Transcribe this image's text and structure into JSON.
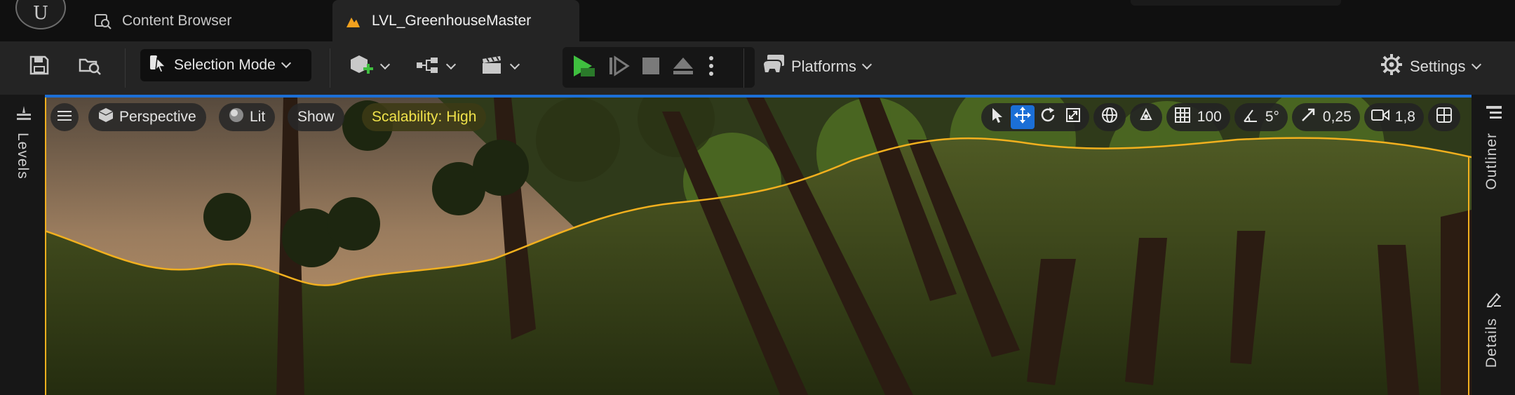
{
  "title_bar": {
    "tabs": [
      {
        "label": "Content Browser",
        "icon": "content-browser-icon"
      },
      {
        "label": "LVL_GreenhouseMaster",
        "icon": "level-icon"
      }
    ]
  },
  "toolbar": {
    "selection_mode": "Selection Mode",
    "platforms": "Platforms",
    "settings": "Settings"
  },
  "left_panel": {
    "levels_label": "Levels"
  },
  "right_panel": {
    "outliner_label": "Outliner",
    "details_label": "Details"
  },
  "viewport": {
    "perspective": "Perspective",
    "lit": "Lit",
    "show": "Show",
    "scalability": "Scalability: High",
    "grid_snap": "100",
    "rotation_snap": "5°",
    "scale_snap": "0,25",
    "camera_speed": "1,8"
  },
  "colors": {
    "accent": "#1b6fd6",
    "play": "#3fbf3f",
    "scalability_text": "#f0e24a",
    "selection_outline": "#f2b01e"
  }
}
